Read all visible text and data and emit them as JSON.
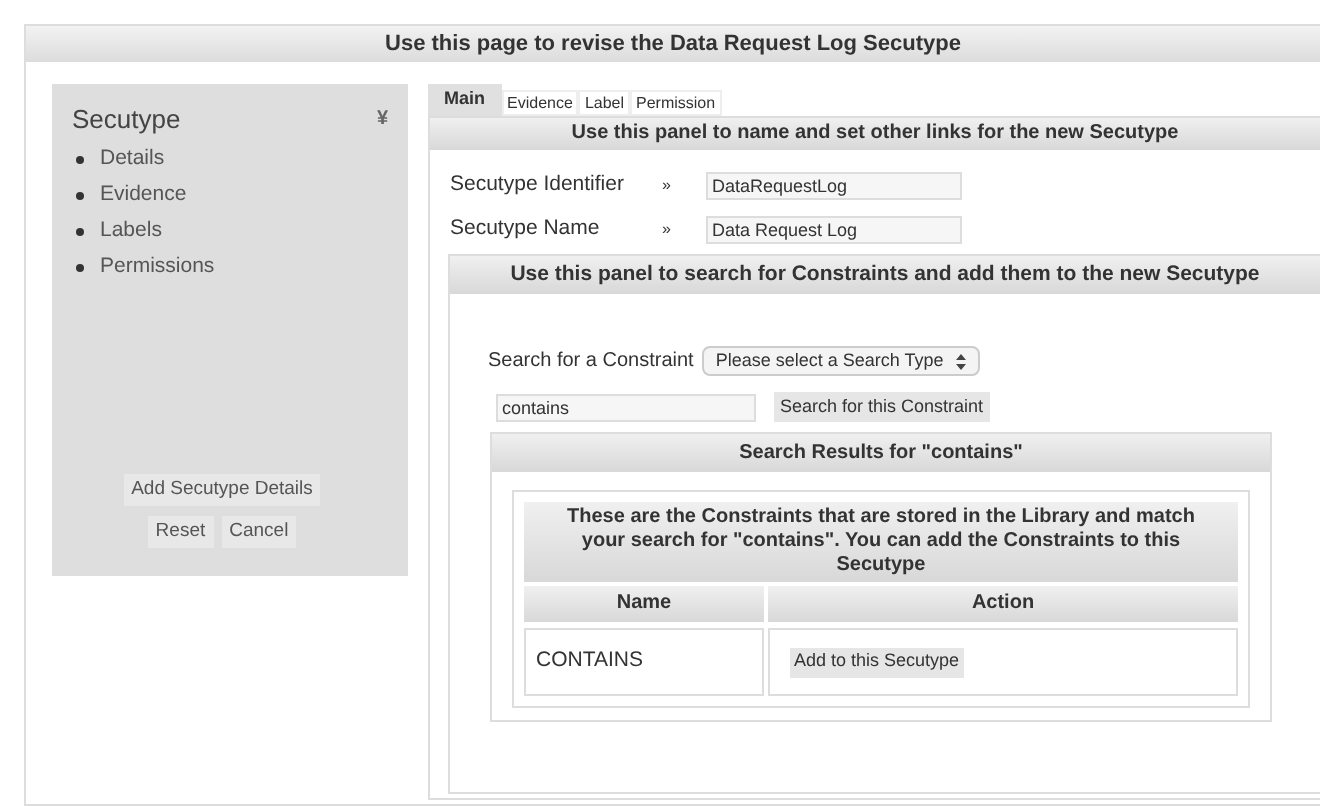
{
  "page_title": "Use this page to revise the Data Request Log Secutype",
  "sidebar": {
    "title": "Secutype",
    "collapse_glyph": "¥",
    "items": [
      "Details",
      "Evidence",
      "Labels",
      "Permissions"
    ],
    "buttons": [
      "Add Secutype Details",
      "Reset",
      "Cancel"
    ]
  },
  "tabs": [
    {
      "label": "Main",
      "selected": true
    },
    {
      "label": "Evidence",
      "selected": false
    },
    {
      "label": "Label",
      "selected": false
    },
    {
      "label": "Permission",
      "selected": false
    }
  ],
  "main_panel": {
    "title": "Use this panel to name and set other links for the new Secutype",
    "fields": [
      {
        "label": "Secutype Identifier",
        "marker": "»",
        "value": "DataRequestLog"
      },
      {
        "label": "Secutype Name",
        "marker": "»",
        "value": "Data Request Log"
      }
    ]
  },
  "constraint_panel": {
    "title": "Use this panel to search for Constraints and add them to the new Secutype",
    "search_label": "Search for a Constraint",
    "search_type": "Please select a Search Type",
    "query": "contains",
    "search_button": "Search for this Constraint",
    "results": {
      "title": "Search Results for \"contains\"",
      "description": "These are the Constraints that are stored in the Library and match your search for \"contains\". You can add the Constraints to this Secutype",
      "columns": [
        "Name",
        "Action"
      ],
      "rows": [
        {
          "name": "CONTAINS",
          "action": "Add to this Secutype"
        }
      ]
    }
  }
}
